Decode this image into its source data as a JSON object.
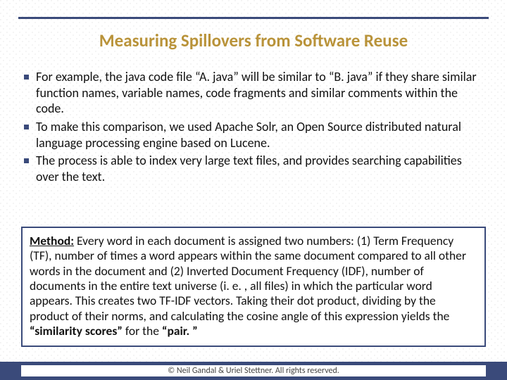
{
  "title": "Measuring Spillovers from Software Reuse",
  "bullets": {
    "b1": "For example, the java code file “A. java” will be similar to “B. java” if they share similar function names, variable names, code fragments and similar comments within the code.",
    "b2": "To make this comparison, we used Apache Solr, an Open Source distributed natural language processing engine based on Lucene.",
    "b3": "The process is able to index very large text files, and provides searching capabilities over the text."
  },
  "method": {
    "label": "Method:",
    "body1": " Every word in each document is assigned two numbers: (1) Term Frequency (TF), number of times a word appears within the same document compared to all other words in the document and (2) Inverted Document Frequency (IDF), number of documents in the entire text universe (i. e. , all files) in which the particular word appears.  This creates two TF-IDF vectors. Taking their dot product, dividing by the product of their norms, and calculating the cosine angle of this expression yields the ",
    "sim": "“similarity scores”",
    "body2": " for the ",
    "pair": "“pair. ”"
  },
  "footer": "© Neil Gandal & Uriel Stettner. All rights reserved."
}
